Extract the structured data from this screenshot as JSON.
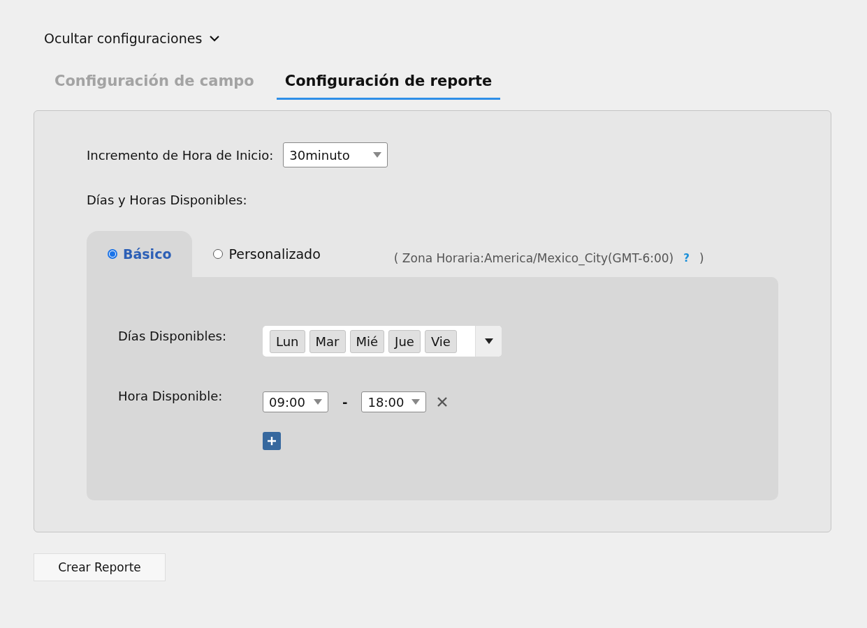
{
  "toggle": {
    "label": "Ocultar configuraciones",
    "expanded": true
  },
  "tabs": [
    {
      "label": "Configuración de campo",
      "selected": false
    },
    {
      "label": "Configuración de reporte",
      "selected": true
    }
  ],
  "increment": {
    "label": "Incremento de Hora de Inicio:",
    "value": "30minuto"
  },
  "availability": {
    "label": "Días y Horas Disponibles:",
    "modes": [
      {
        "label": "Básico",
        "selected": true
      },
      {
        "label": "Personalizado",
        "selected": false
      }
    ],
    "timezone": {
      "open": "( Zona Horaria:America/Mexico_City(GMT-6:00)",
      "help": "?",
      "close": ")"
    },
    "days": {
      "label": "Días Disponibles:",
      "chips": [
        "Lun",
        "Mar",
        "Mié",
        "Jue",
        "Vie"
      ]
    },
    "hours": {
      "label": "Hora Disponible:",
      "from": "09:00",
      "separator": "-",
      "to": "18:00"
    }
  },
  "button": "Crear Reporte"
}
